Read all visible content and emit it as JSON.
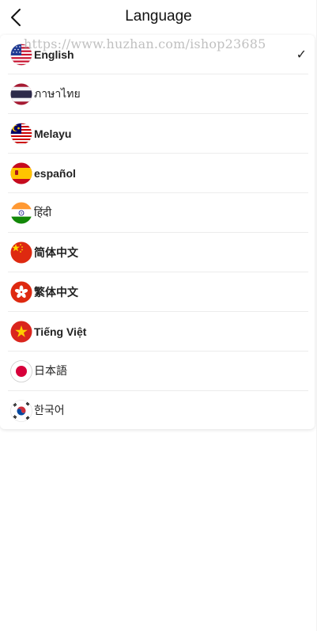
{
  "header": {
    "title": "Language",
    "back_icon": "chevron-left-icon"
  },
  "watermark": "https://www.huzhan.com/ishop23685",
  "selected_marker": "✓",
  "languages": [
    {
      "label": "English",
      "flag": "us-flag-icon",
      "selected": true
    },
    {
      "label": "ภาษาไทย",
      "flag": "thailand-flag-icon",
      "selected": false
    },
    {
      "label": "Melayu",
      "flag": "malaysia-flag-icon",
      "selected": false
    },
    {
      "label": "español",
      "flag": "spain-flag-icon",
      "selected": false
    },
    {
      "label": "हिंदी",
      "flag": "india-flag-icon",
      "selected": false
    },
    {
      "label": "简体中文",
      "flag": "china-flag-icon",
      "selected": false
    },
    {
      "label": "繁体中文",
      "flag": "hong-kong-flag-icon",
      "selected": false
    },
    {
      "label": "Tiếng Việt",
      "flag": "vietnam-flag-icon",
      "selected": false
    },
    {
      "label": "日本語",
      "flag": "japan-flag-icon",
      "selected": false
    },
    {
      "label": "한국어",
      "flag": "korea-flag-icon",
      "selected": false
    }
  ]
}
